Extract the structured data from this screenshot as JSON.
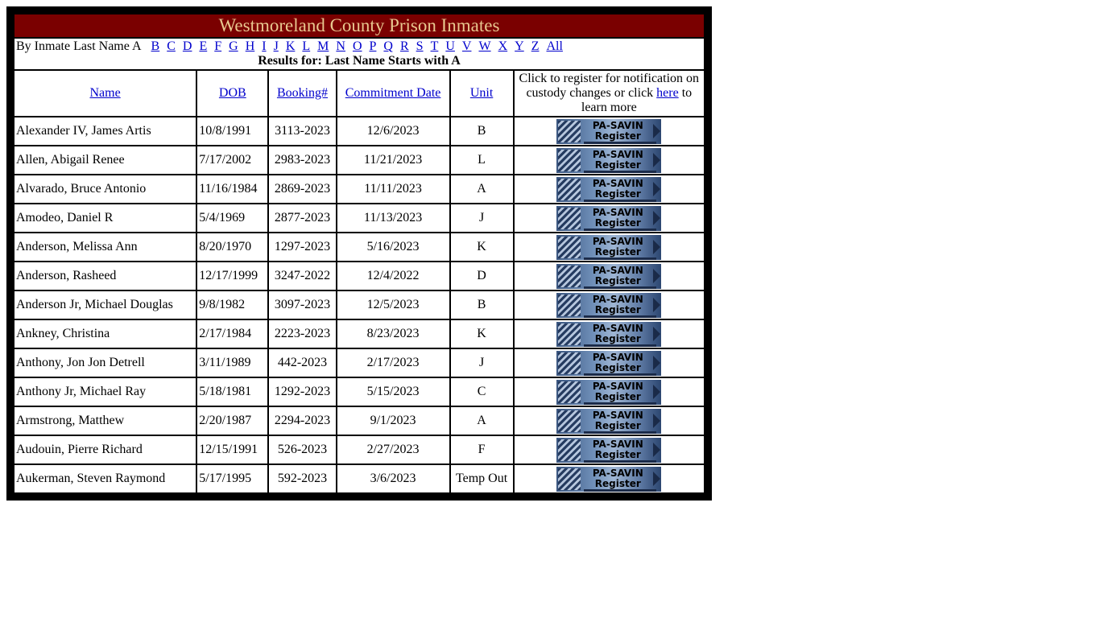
{
  "title": "Westmoreland County Prison Inmates",
  "alpha_prefix": "By Inmate Last Name",
  "alpha_current": "A",
  "alpha_links": [
    "B",
    "C",
    "D",
    "E",
    "F",
    "G",
    "H",
    "I",
    "J",
    "K",
    "L",
    "M",
    "N",
    "O",
    "P",
    "Q",
    "R",
    "S",
    "T",
    "U",
    "V",
    "W",
    "X",
    "Y",
    "Z",
    "All"
  ],
  "results_label": "Results for: Last Name Starts with A",
  "headers": {
    "name": "Name",
    "dob": "DOB",
    "booking": "Booking#",
    "commitment": "Commitment Date",
    "unit": "Unit",
    "notify_pre": "Click to register for notification on custody changes or click",
    "notify_link": "here",
    "notify_post": "to learn more"
  },
  "savin": {
    "line1": "PA-SAVIN",
    "line2": "Register"
  },
  "colors": {
    "title_bg": "#7a0000",
    "title_text": "#e8c890",
    "link": "#0000cc",
    "frame": "#000000"
  },
  "rows": [
    {
      "name": "Alexander IV, James Artis",
      "dob": "10/8/1991",
      "booking": "3113-2023",
      "commitment": "12/6/2023",
      "unit": "B"
    },
    {
      "name": "Allen, Abigail Renee",
      "dob": "7/17/2002",
      "booking": "2983-2023",
      "commitment": "11/21/2023",
      "unit": "L"
    },
    {
      "name": "Alvarado, Bruce Antonio",
      "dob": "11/16/1984",
      "booking": "2869-2023",
      "commitment": "11/11/2023",
      "unit": "A"
    },
    {
      "name": "Amodeo, Daniel R",
      "dob": "5/4/1969",
      "booking": "2877-2023",
      "commitment": "11/13/2023",
      "unit": "J"
    },
    {
      "name": "Anderson, Melissa Ann",
      "dob": "8/20/1970",
      "booking": "1297-2023",
      "commitment": "5/16/2023",
      "unit": "K"
    },
    {
      "name": "Anderson, Rasheed",
      "dob": "12/17/1999",
      "booking": "3247-2022",
      "commitment": "12/4/2022",
      "unit": "D"
    },
    {
      "name": "Anderson Jr, Michael Douglas",
      "dob": "9/8/1982",
      "booking": "3097-2023",
      "commitment": "12/5/2023",
      "unit": "B"
    },
    {
      "name": "Ankney, Christina",
      "dob": "2/17/1984",
      "booking": "2223-2023",
      "commitment": "8/23/2023",
      "unit": "K"
    },
    {
      "name": "Anthony, Jon Jon Detrell",
      "dob": "3/11/1989",
      "booking": "442-2023",
      "commitment": "2/17/2023",
      "unit": "J"
    },
    {
      "name": "Anthony Jr, Michael Ray",
      "dob": "5/18/1981",
      "booking": "1292-2023",
      "commitment": "5/15/2023",
      "unit": "C"
    },
    {
      "name": "Armstrong, Matthew",
      "dob": "2/20/1987",
      "booking": "2294-2023",
      "commitment": "9/1/2023",
      "unit": "A"
    },
    {
      "name": "Audouin, Pierre Richard",
      "dob": "12/15/1991",
      "booking": "526-2023",
      "commitment": "2/27/2023",
      "unit": "F"
    },
    {
      "name": "Aukerman, Steven Raymond",
      "dob": "5/17/1995",
      "booking": "592-2023",
      "commitment": "3/6/2023",
      "unit": "Temp Out"
    }
  ]
}
